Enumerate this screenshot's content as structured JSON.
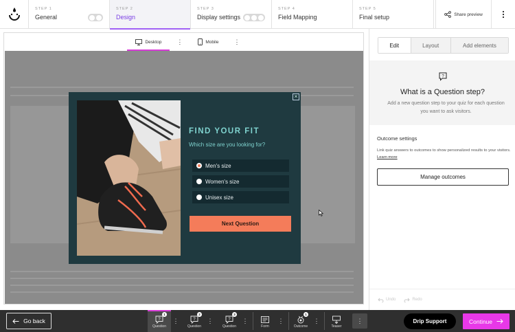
{
  "stepper": {
    "steps": [
      {
        "num": "STEP 1",
        "name": "General"
      },
      {
        "num": "STEP 2",
        "name": "Design"
      },
      {
        "num": "STEP 3",
        "name": "Display settings"
      },
      {
        "num": "STEP 4",
        "name": "Field Mapping"
      },
      {
        "num": "STEP 5",
        "name": "Final setup"
      }
    ],
    "share_label": "Share preview"
  },
  "canvas": {
    "devices": [
      {
        "label": "Desktop",
        "icon": "monitor-icon"
      },
      {
        "label": "Mobile",
        "icon": "phone-icon"
      }
    ]
  },
  "quiz": {
    "title": "FIND YOUR FIT",
    "subtitle": "Which size are you looking for?",
    "options": [
      "Men's size",
      "Women's size",
      "Unisex size"
    ],
    "selected_option": "Men's size",
    "next_label": "Next Question",
    "accent": "#f47c5a",
    "background": "#1f3a40"
  },
  "panel": {
    "tabs": [
      "Edit",
      "Layout",
      "Add elements"
    ],
    "active_tab": "Edit",
    "info_title": "What is a Question step?",
    "info_desc": "Add a new question step to your quiz for each question you want to ask visitors.",
    "outcome_title": "Outcome settings",
    "outcome_desc": "Link quiz answers to outcomes to show personalized results to your visitors.",
    "learn_more": "Learn more",
    "manage_label": "Manage outcomes",
    "undo": "Undo",
    "redo": "Redo"
  },
  "bottombar": {
    "back_label": "Go back",
    "steps": [
      {
        "label": "Question",
        "badge": "1"
      },
      {
        "label": "Question",
        "badge": "2"
      },
      {
        "label": "Question",
        "badge": "3"
      },
      {
        "label": "Form",
        "badge": ""
      },
      {
        "label": "Outcome",
        "badge": "1"
      },
      {
        "label": "Teaser",
        "badge": ""
      }
    ],
    "support_label": "Drip Support",
    "continue_label": "Continue",
    "accent": "#e838e8"
  }
}
